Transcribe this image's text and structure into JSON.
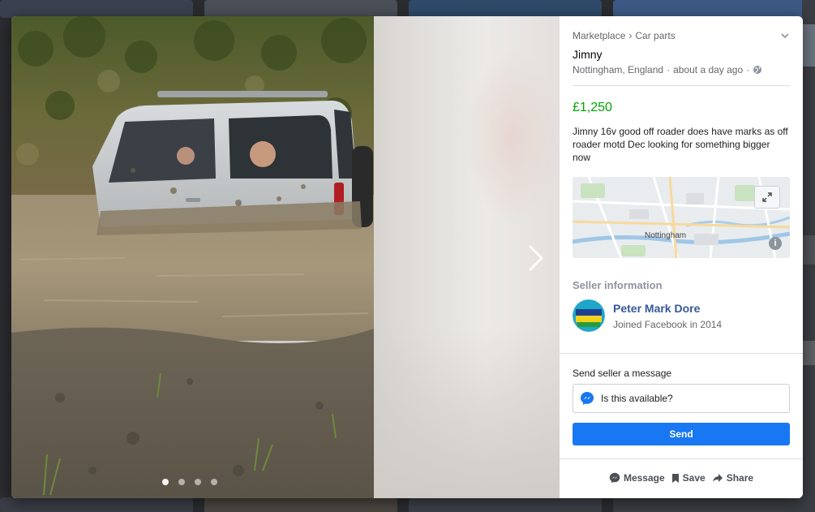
{
  "breadcrumb": {
    "marketplace": "Marketplace",
    "separator": "›",
    "category": "Car parts"
  },
  "listing": {
    "title": "Jimny",
    "location": "Nottingham, England",
    "time": "about a day ago",
    "meta_sep": "·",
    "price": "£1,250",
    "description": "Jimny 16v good off roader does have marks as off roader motd Dec looking for something bigger now"
  },
  "map": {
    "label": "Nottingham",
    "info_glyph": "i"
  },
  "seller": {
    "section_label": "Seller information",
    "name": "Peter Mark Dore",
    "joined": "Joined Facebook in 2014"
  },
  "message": {
    "heading": "Send seller a message",
    "input_value": "Is this available?",
    "send_label": "Send"
  },
  "actions": {
    "message_label": "Message",
    "save_label": "Save",
    "share_label": "Share"
  },
  "photo": {
    "dot_count": 4,
    "active_dot": 1
  },
  "colors": {
    "price": "#00a400",
    "send_button": "#1877f2",
    "seller_name": "#365899",
    "messenger": "#1877f2"
  },
  "icons": [
    "chevron-down-icon",
    "globe-icon",
    "expand-icon",
    "info-icon",
    "messenger-icon",
    "bookmark-icon",
    "share-icon",
    "chevron-right-icon"
  ]
}
